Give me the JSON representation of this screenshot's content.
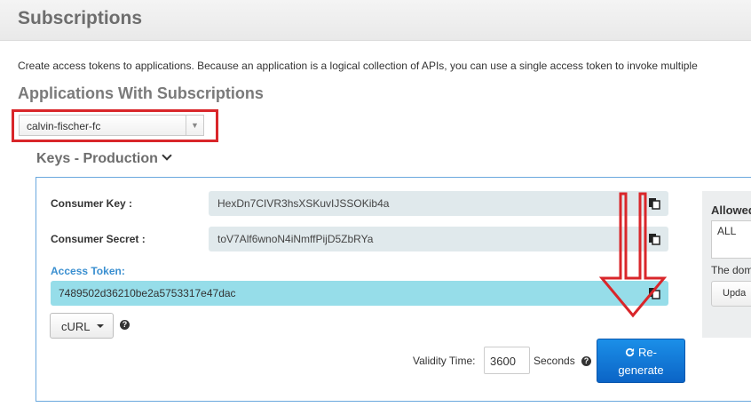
{
  "header": {
    "title": "Subscriptions"
  },
  "description": "Create access tokens to applications. Because an application is a logical collection of APIs, you can use a single access token to invoke multiple",
  "applications": {
    "title": "Applications With Subscriptions",
    "selected": "calvin-fischer-fc"
  },
  "keys": {
    "title": "Keys - Production",
    "consumer_key_label": "Consumer Key :",
    "consumer_key": "HexDn7CIVR3hsXSKuvIJSSOKib4a",
    "consumer_secret_label": "Consumer Secret :",
    "consumer_secret": "toV7Alf6wnoN4iNmffPijD5ZbRYa",
    "access_token_label": "Access Token:",
    "access_token": "7489502d36210be2a5753317e47dac",
    "curl_label": "cURL",
    "validity_label": "Validity Time:",
    "validity_value": "3600",
    "seconds_label": "Seconds",
    "regenerate_line1": "Re-",
    "regenerate_line2": "generate",
    "help_glyph": "?"
  },
  "domains": {
    "title": "Allowed",
    "value": "ALL",
    "note": "The dom",
    "update_label": "Upda"
  },
  "annotation_color": "#d9262a"
}
